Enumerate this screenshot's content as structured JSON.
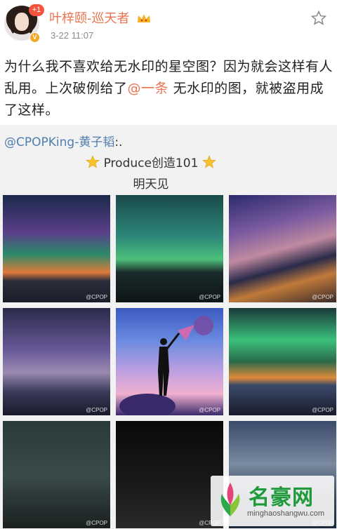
{
  "header": {
    "username": "叶梓颐-巡天者",
    "timestamp": "3-22 11:07",
    "notification_count": "+1",
    "verified_label": "V"
  },
  "post": {
    "text_part1": "为什么我不喜欢给无水印的星空图？因为就会这样有人乱用。上次破例给了",
    "mention": "@一条",
    "text_part2": " 无水印的图，就被盗用成了这样。"
  },
  "repost": {
    "author": "@CPOPKing-黄子韬",
    "author_tail": ":.",
    "line1": "Produce创造101",
    "line2": "明天见"
  },
  "watermark_tile": "@CPOP",
  "site_watermark": {
    "name": "名豪网",
    "url": "minghaoshangwu.com"
  },
  "colors": {
    "username": "#eb7350",
    "mention": "#507daf",
    "badge": "#f5533d",
    "verified": "#f5a623"
  }
}
